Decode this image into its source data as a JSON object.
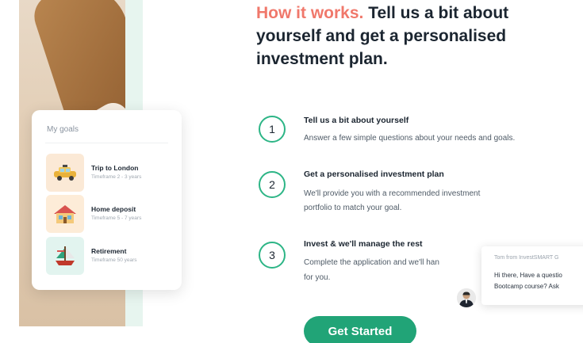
{
  "heading": {
    "accent": "How it works.",
    "rest": " Tell us a bit about yourself and get a personalised investment plan."
  },
  "goals": {
    "title": "My goals",
    "items": [
      {
        "name": "Trip to London",
        "timeframe": "Timeframe 2 - 3 years",
        "icon": "car-icon"
      },
      {
        "name": "Home deposit",
        "timeframe": "Timeframe 5 - 7 years",
        "icon": "house-icon"
      },
      {
        "name": "Retirement",
        "timeframe": "Timeframe 50 years",
        "icon": "boat-icon"
      }
    ]
  },
  "steps": [
    {
      "number": "1",
      "title": "Tell us a bit about yourself",
      "desc1": "Answer a few simple questions about your needs and goals.",
      "desc2": ""
    },
    {
      "number": "2",
      "title": "Get a personalised investment plan",
      "desc1": "We'll provide you with a recommended investment",
      "desc2": "portfolio to match your goal."
    },
    {
      "number": "3",
      "title": "Invest & we'll manage the rest",
      "desc1": "Complete the application and we'll han",
      "desc2": "for you."
    }
  ],
  "chat": {
    "from": "Tom from InvestSMART G",
    "line1": "Hi there,  Have a questio",
    "line2": "Bootcamp course?  Ask"
  },
  "cta": {
    "label": "Get Started"
  },
  "colors": {
    "accent": "#f0786b",
    "brand_green": "#21a477",
    "step_ring": "#2db586"
  }
}
